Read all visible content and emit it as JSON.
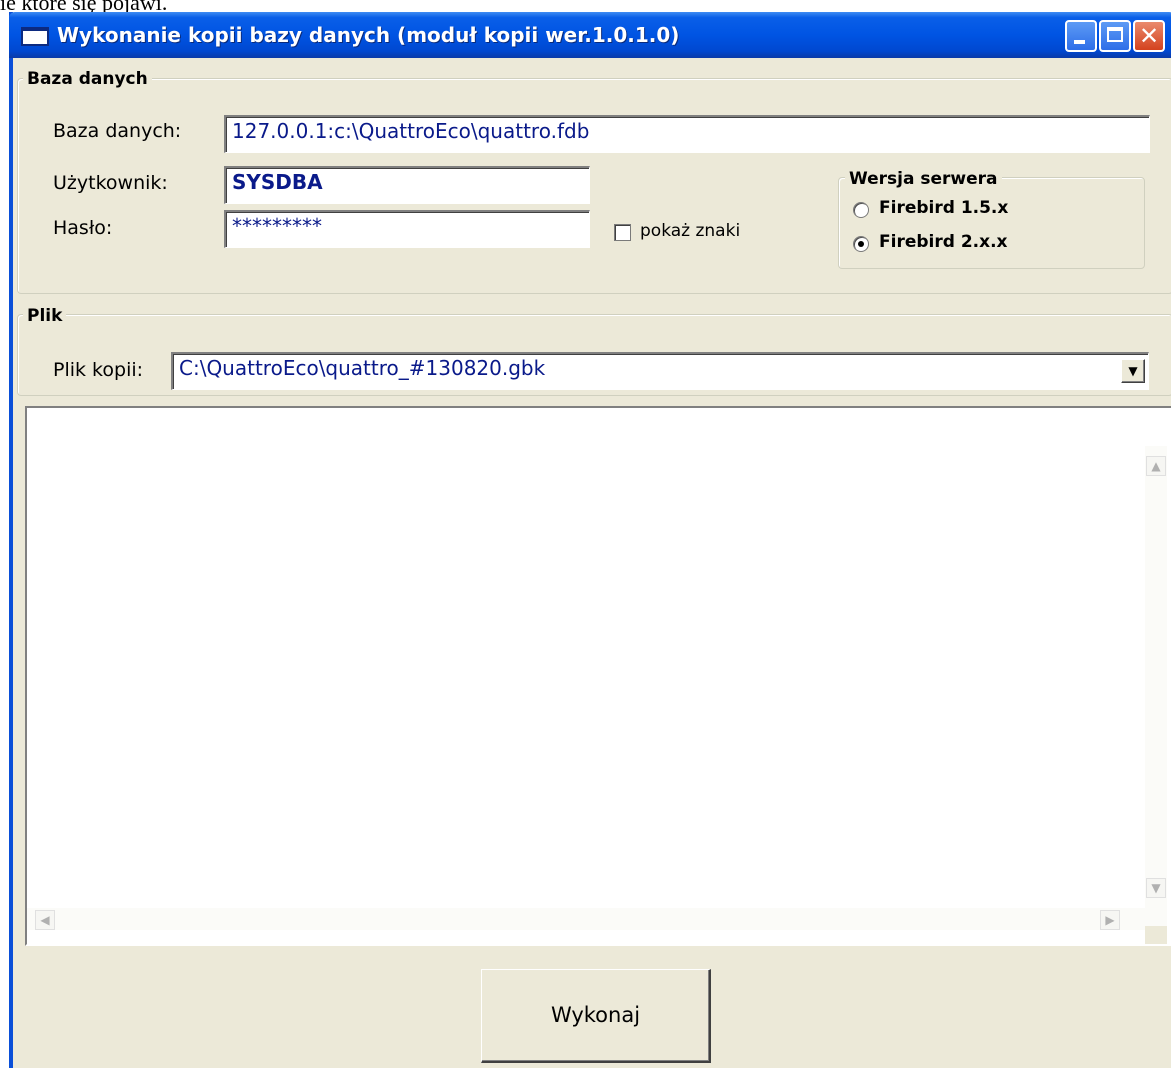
{
  "caption": "ie które się pojawi.",
  "window": {
    "title": "Wykonanie kopii bazy danych (moduł kopii wer.1.0.1.0)",
    "accent": "#0054e3"
  },
  "group_db": {
    "legend": "Baza danych",
    "database_label": "Baza danych:",
    "database_value": "127.0.0.1:c:\\QuattroEco\\quattro.fdb",
    "user_label": "Użytkownik:",
    "user_value": "SYSDBA",
    "password_label": "Hasło:",
    "password_value": "*********",
    "show_chars_label": "pokaż znaki",
    "show_chars_checked": false
  },
  "server_version": {
    "legend": "Wersja serwera",
    "options": [
      "Firebird 1.5.x",
      "Firebird 2.x.x"
    ],
    "selected": "Firebird 2.x.x"
  },
  "group_file": {
    "legend": "Plik",
    "backup_label": "Plik kopii:",
    "backup_value": "C:\\QuattroEco\\quattro_#130820.gbk"
  },
  "log": {
    "text": ""
  },
  "actions": {
    "execute_label": "Wykonaj"
  }
}
